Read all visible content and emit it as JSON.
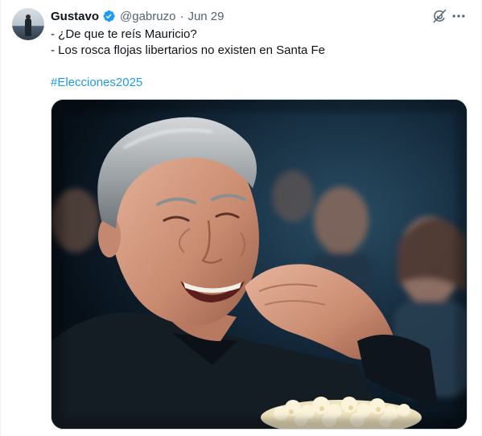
{
  "tweet": {
    "author_name": "Gustavo",
    "author_handle": "@gabruzo",
    "separator": "·",
    "date": "Jun 29",
    "lines": [
      "- ¿De que te reís Mauricio?",
      "- Los rosca flojas libertarios no existen en Santa Fe"
    ],
    "hashtag": "#Elecciones2025"
  },
  "icons": {
    "verified": "verified-badge-icon",
    "grok": "grok-icon",
    "more": "more-options-icon"
  },
  "colors": {
    "verified_blue": "#1d9bf0",
    "hashtag_blue": "#1d9bf0",
    "secondary_text": "#536471",
    "primary_text": "#0f1419"
  }
}
